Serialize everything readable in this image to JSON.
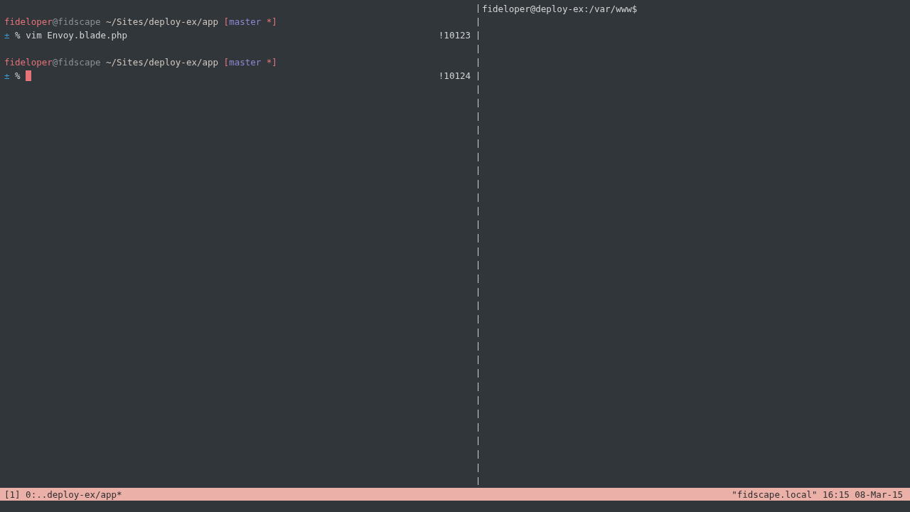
{
  "left_pane": {
    "blocks": [
      {
        "prompt": {
          "user": "fideloper",
          "at": "@",
          "host": "fidscape",
          "path": "~/Sites/deploy-ex/app",
          "bracket_open": "[",
          "branch": "master",
          "bracket_close": "*]"
        },
        "command": {
          "marker": "±",
          "sign": "%",
          "text": "vim Envoy.blade.php",
          "history": "!10123",
          "cursor": false
        }
      },
      {
        "prompt": {
          "user": "fideloper",
          "at": "@",
          "host": "fidscape",
          "path": "~/Sites/deploy-ex/app",
          "bracket_open": "[",
          "branch": "master",
          "bracket_close": "*]"
        },
        "command": {
          "marker": "±",
          "sign": "%",
          "history": "!10124",
          "cursor": true
        }
      }
    ]
  },
  "right_pane": {
    "prompt": "fideloper@deploy-ex:/var/www$"
  },
  "status_bar": {
    "left": "[1] 0:..deploy-ex/app*",
    "right": "\"fidscape.local\" 16:15 08-Mar-15"
  }
}
